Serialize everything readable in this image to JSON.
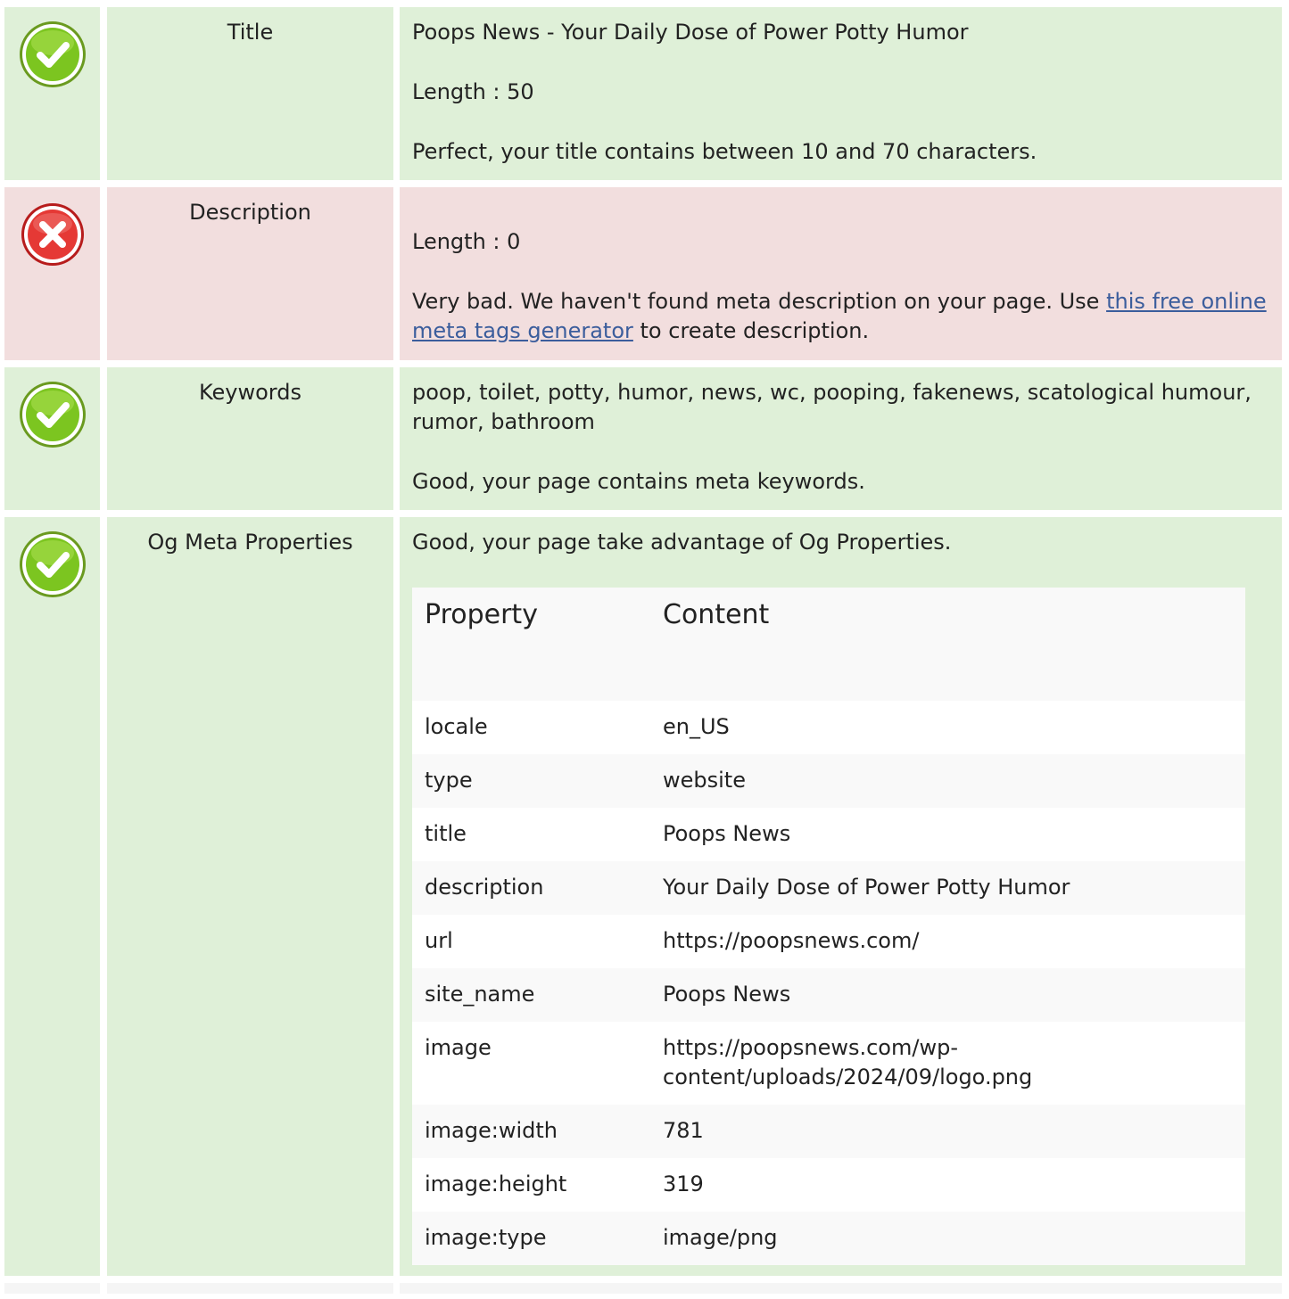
{
  "rows": {
    "title": {
      "status": "good",
      "label": "Title",
      "value": "Poops News - Your Daily Dose of Power Potty Humor",
      "length": "Length : 50",
      "message": "Perfect, your title contains between 10 and 70 characters."
    },
    "description": {
      "status": "bad",
      "label": "Description",
      "length": "Length : 0",
      "message_before": "Very bad. We haven't found meta description on your page. Use ",
      "link_text": "this free online meta tags generator",
      "message_after": " to create description."
    },
    "keywords": {
      "status": "good",
      "label": "Keywords",
      "value": "poop, toilet, potty, humor, news, wc, pooping, fakenews, scatological humour, rumor, bathroom",
      "message": "Good, your page contains meta keywords."
    },
    "og": {
      "status": "good",
      "label": "Og Meta Properties",
      "message": "Good, your page take advantage of Og Properties.",
      "table_headers": [
        "Property",
        "Content"
      ],
      "table_rows": [
        [
          "locale",
          "en_US"
        ],
        [
          "type",
          "website"
        ],
        [
          "title",
          "Poops News"
        ],
        [
          "description",
          "Your Daily Dose of Power Potty Humor"
        ],
        [
          "url",
          "https://poopsnews.com/"
        ],
        [
          "site_name",
          "Poops News"
        ],
        [
          "image",
          "https://poopsnews.com/wp-content/uploads/2024/09/logo.png"
        ],
        [
          "image:width",
          "781"
        ],
        [
          "image:height",
          "319"
        ],
        [
          "image:type",
          "image/png"
        ]
      ]
    }
  },
  "icons": {
    "good": "check-icon",
    "bad": "cross-icon"
  },
  "colors": {
    "good_bg": "#dff0d8",
    "bad_bg": "#f2dede",
    "good_icon": "#7cc520",
    "bad_icon": "#e53935",
    "link": "#3b5d9c"
  }
}
